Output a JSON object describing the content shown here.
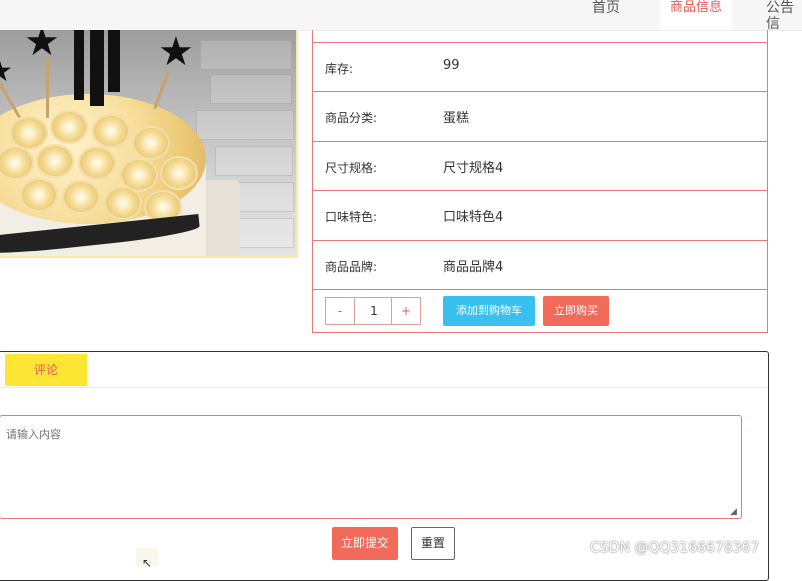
{
  "nav": {
    "home": "首页",
    "products": "商品信息",
    "notices": "公告信"
  },
  "product": {
    "rows": [
      {
        "label": "库存:",
        "value": "99"
      },
      {
        "label": "商品分类:",
        "value": "蛋糕"
      },
      {
        "label": "尺寸规格:",
        "value": "尺寸规格4"
      },
      {
        "label": "口味特色:",
        "value": "口味特色4"
      },
      {
        "label": "商品品牌:",
        "value": "商品品牌4"
      }
    ],
    "quantity": {
      "minus": "-",
      "value": "1",
      "plus": "+"
    },
    "add_to_cart": "添加到购物车",
    "buy_now": "立即购买"
  },
  "comment": {
    "tab": "评论",
    "placeholder": "请输入内容",
    "submit": "立即提交",
    "reset": "重置"
  },
  "watermark": "CSDN @QQ3166678367",
  "colors": {
    "accent_red": "#f26a5a",
    "border_red": "#e87878",
    "cart_blue": "#39c0ef",
    "tab_yellow": "#fde534"
  }
}
